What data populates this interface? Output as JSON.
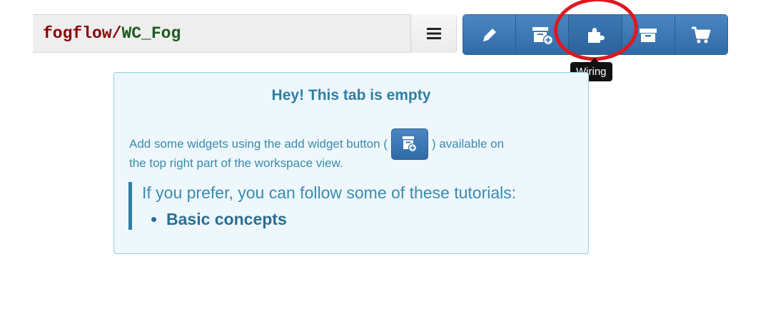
{
  "workspace": {
    "owner": "fogflow",
    "separator": "/",
    "name": "WC_Fog"
  },
  "toolbar": {
    "buttons": [
      {
        "name": "edit",
        "icon": "pencil-icon"
      },
      {
        "name": "add-widget",
        "icon": "add-widget-icon"
      },
      {
        "name": "wiring",
        "icon": "puzzle-icon"
      },
      {
        "name": "components",
        "icon": "archive-icon"
      },
      {
        "name": "marketplace",
        "icon": "cart-icon"
      }
    ]
  },
  "tooltip": {
    "text": "Wiring"
  },
  "panel": {
    "title": "Hey! This tab is empty",
    "line1_before": "Add some widgets using the add widget button (",
    "line1_after": ") available on",
    "line2": "the top right part of the workspace view.",
    "tutorials_intro": "If you prefer, you can follow some of these tutorials:",
    "tutorials": [
      "Basic concepts"
    ]
  },
  "colors": {
    "primary": "#3a7ab9",
    "info_bg": "#eef7fb",
    "info_text": "#3a8bb0",
    "highlight": "#e0171f"
  }
}
